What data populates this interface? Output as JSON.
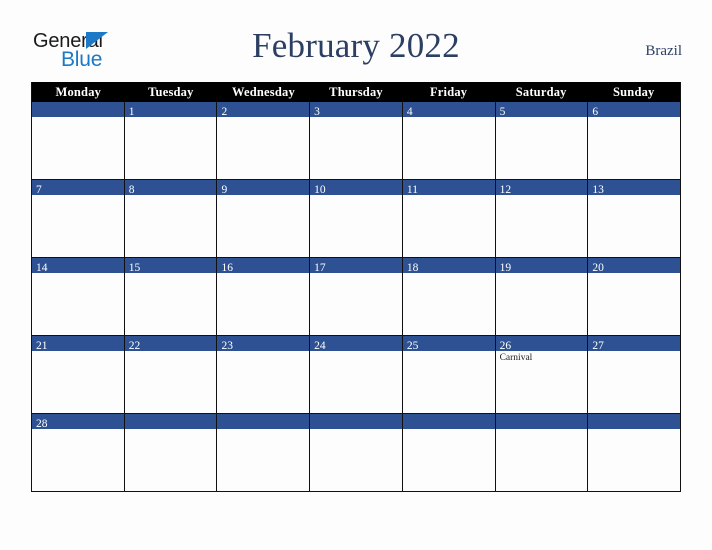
{
  "brand": {
    "name_part1": "General",
    "name_part2": "Blue",
    "triangle_color": "#1b79c8"
  },
  "header": {
    "title": "February 2022",
    "region": "Brazil",
    "title_color": "#2c3f63"
  },
  "calendar": {
    "month": "February",
    "year": "2022",
    "accent_color": "#2d5192",
    "header_bg": "#000000",
    "day_names": [
      "Monday",
      "Tuesday",
      "Wednesday",
      "Thursday",
      "Friday",
      "Saturday",
      "Sunday"
    ],
    "weeks": [
      [
        {
          "date": "",
          "events": []
        },
        {
          "date": "1",
          "events": []
        },
        {
          "date": "2",
          "events": []
        },
        {
          "date": "3",
          "events": []
        },
        {
          "date": "4",
          "events": []
        },
        {
          "date": "5",
          "events": []
        },
        {
          "date": "6",
          "events": []
        }
      ],
      [
        {
          "date": "7",
          "events": []
        },
        {
          "date": "8",
          "events": []
        },
        {
          "date": "9",
          "events": []
        },
        {
          "date": "10",
          "events": []
        },
        {
          "date": "11",
          "events": []
        },
        {
          "date": "12",
          "events": []
        },
        {
          "date": "13",
          "events": []
        }
      ],
      [
        {
          "date": "14",
          "events": []
        },
        {
          "date": "15",
          "events": []
        },
        {
          "date": "16",
          "events": []
        },
        {
          "date": "17",
          "events": []
        },
        {
          "date": "18",
          "events": []
        },
        {
          "date": "19",
          "events": []
        },
        {
          "date": "20",
          "events": []
        }
      ],
      [
        {
          "date": "21",
          "events": []
        },
        {
          "date": "22",
          "events": []
        },
        {
          "date": "23",
          "events": []
        },
        {
          "date": "24",
          "events": []
        },
        {
          "date": "25",
          "events": []
        },
        {
          "date": "26",
          "events": [
            "Carnival"
          ]
        },
        {
          "date": "27",
          "events": []
        }
      ],
      [
        {
          "date": "28",
          "events": []
        },
        {
          "date": "",
          "events": []
        },
        {
          "date": "",
          "events": []
        },
        {
          "date": "",
          "events": []
        },
        {
          "date": "",
          "events": []
        },
        {
          "date": "",
          "events": []
        },
        {
          "date": "",
          "events": []
        }
      ]
    ]
  }
}
